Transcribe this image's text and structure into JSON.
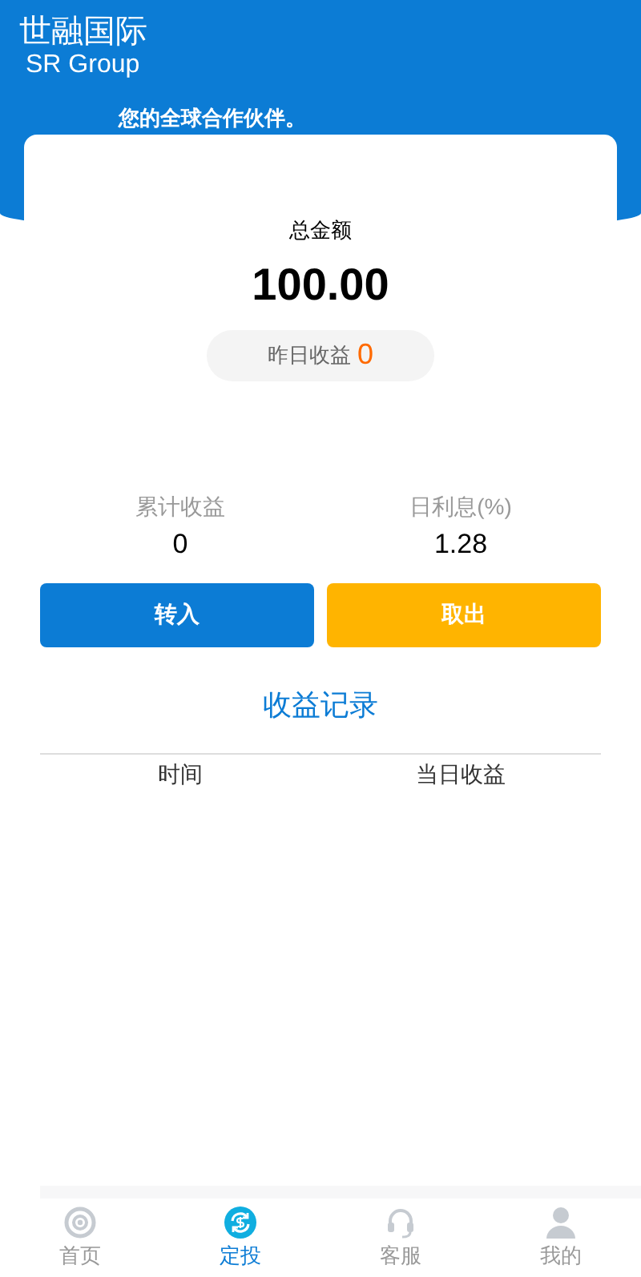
{
  "header": {
    "title": "世融国际",
    "subtitle": "SR Group",
    "slogan": "您的全球合作伙伴。"
  },
  "balance": {
    "label": "总金额",
    "amount": "100.00",
    "yesterday_label": "昨日收益",
    "yesterday_value": "0"
  },
  "stats": [
    {
      "label": "累计收益",
      "value": "0"
    },
    {
      "label": "日利息(%)",
      "value": "1.28"
    }
  ],
  "buttons": [
    {
      "label": "转入",
      "kind": "primary"
    },
    {
      "label": "取出",
      "kind": "warning"
    }
  ],
  "records_link": "收益记录",
  "table": {
    "columns": [
      "时间",
      "当日收益"
    ]
  },
  "nav": [
    {
      "label": "首页",
      "kind": "home",
      "selected": false
    },
    {
      "label": "定投",
      "kind": "invest",
      "selected": true
    },
    {
      "label": "客服",
      "kind": "support",
      "selected": false
    },
    {
      "label": "我的",
      "kind": "profile",
      "selected": false
    }
  ]
}
